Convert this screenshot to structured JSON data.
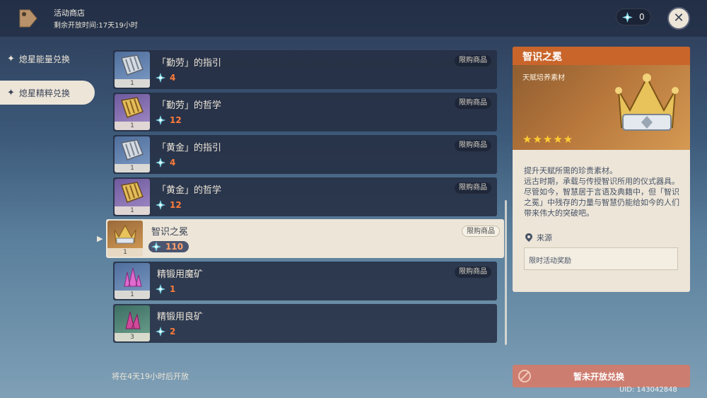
{
  "header": {
    "title": "活动商店",
    "timer": "剩余开放时间:17天19小时",
    "currency_value": "0",
    "close_label": "✕"
  },
  "sidebar": {
    "items": [
      {
        "label": "熄星能量兑换",
        "active": false
      },
      {
        "label": "熄星精粹兑换",
        "active": true
      }
    ]
  },
  "items": [
    {
      "name": "「勤劳」的指引",
      "price": "4",
      "count": "1",
      "badge": "限购商品",
      "rarity": "blue",
      "icon": "guide-book-icon"
    },
    {
      "name": "「勤劳」的哲学",
      "price": "12",
      "count": "1",
      "badge": "限购商品",
      "rarity": "purple",
      "icon": "philosophy-book-icon"
    },
    {
      "name": "「黄金」的指引",
      "price": "4",
      "count": "1",
      "badge": "限购商品",
      "rarity": "blue",
      "icon": "guide-book-icon"
    },
    {
      "name": "「黄金」的哲学",
      "price": "12",
      "count": "1",
      "badge": "限购商品",
      "rarity": "purple",
      "icon": "philosophy-book-icon"
    },
    {
      "name": "智识之冕",
      "price": "110",
      "count": "1",
      "badge": "限购商品",
      "rarity": "gold",
      "icon": "crown-icon"
    },
    {
      "name": "精锻用魔矿",
      "price": "1",
      "count": "1",
      "badge": "限购商品",
      "rarity": "blue",
      "icon": "ore-icon"
    },
    {
      "name": "精锻用良矿",
      "price": "2",
      "count": "3",
      "badge": "",
      "rarity": "green",
      "icon": "ore-icon"
    }
  ],
  "detail": {
    "title": "智识之冕",
    "type": "天赋培养素材",
    "stars": "★★★★★",
    "description": "提升天赋所需的珍贵素材。\n远古时期，承载与传授智识所用的仪式器具。尽管如今，智慧居于言语及典籍中，但「智识之冕」中残存的力量与智慧仍能给如今的人们带来伟大的突破吧。",
    "source_label": "来源",
    "source_value": "限时活动奖励"
  },
  "footer": {
    "opens_text": "将在4天19小时后开放",
    "button_label": "暂未开放兑换",
    "uid": "UID: 143042848"
  },
  "colors": {
    "accent_orange": "#c9652b",
    "price_orange": "#ff7b3a",
    "panel_light": "#ece5d8",
    "list_dark": "#252f43"
  }
}
